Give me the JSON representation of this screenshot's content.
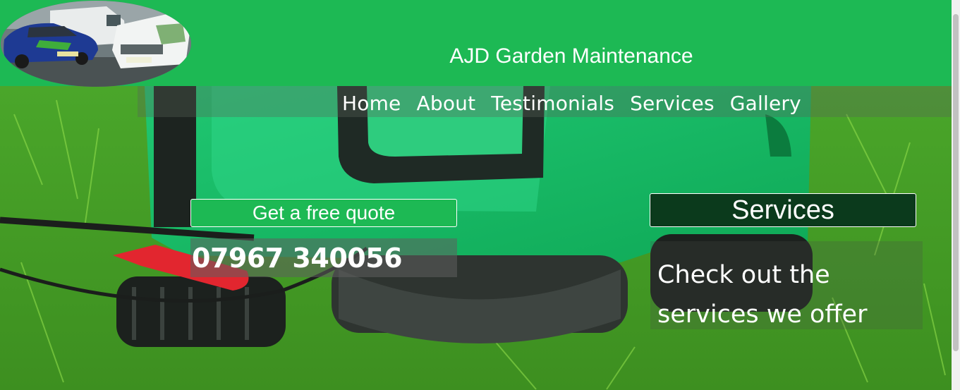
{
  "header": {
    "title": "AJD Garden Maintenance",
    "logo_alt": "vans logo",
    "background_color": "#1db954"
  },
  "nav": {
    "items": [
      {
        "label": "Home"
      },
      {
        "label": "About"
      },
      {
        "label": "Testimonials"
      },
      {
        "label": "Services"
      },
      {
        "label": "Gallery"
      }
    ]
  },
  "hero": {
    "background_image": "lawnmower-on-grass",
    "quote_button_label": "Get a free quote",
    "phone_number": "07967 340056",
    "services_button_label": "Services",
    "services_text": "Check out the services we offer"
  },
  "colors": {
    "accent": "#1db954",
    "dark_green": "#0b3a1c"
  }
}
